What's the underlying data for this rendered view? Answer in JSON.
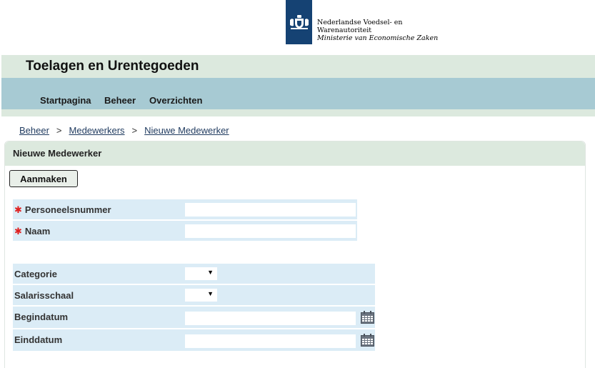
{
  "logo": {
    "line1": "Nederlandse Voedsel- en",
    "line2": "Warenautoriteit",
    "line3": "Ministerie van Economische Zaken"
  },
  "app": {
    "title": "Toelagen en Urentegoeden"
  },
  "nav": {
    "items": [
      "Startpagina",
      "Beheer",
      "Overzichten"
    ]
  },
  "breadcrumb": {
    "items": [
      "Beheer",
      "Medewerkers",
      "Nieuwe Medewerker"
    ],
    "separator": ">"
  },
  "panel": {
    "title": "Nieuwe Medewerker"
  },
  "actions": {
    "create_label": "Aanmaken"
  },
  "required_marker": "✱",
  "form1": {
    "personeelsnummer": {
      "label": "Personeelsnummer",
      "value": ""
    },
    "naam": {
      "label": "Naam",
      "value": ""
    }
  },
  "form2": {
    "categorie": {
      "label": "Categorie",
      "selected": ""
    },
    "salarisschaal": {
      "label": "Salarisschaal",
      "selected": ""
    },
    "begindatum": {
      "label": "Begindatum",
      "value": ""
    },
    "einddatum": {
      "label": "Einddatum",
      "value": ""
    }
  },
  "icons": {
    "dropdown": "chevron-down-icon",
    "calendar": "calendar-icon",
    "logo": "crest-icon"
  },
  "colors": {
    "brand_blue": "#154273",
    "header_green": "#dce9de",
    "nav_blue": "#a7cad3",
    "form_row": "#dbecf6",
    "required_red": "#e02020"
  }
}
